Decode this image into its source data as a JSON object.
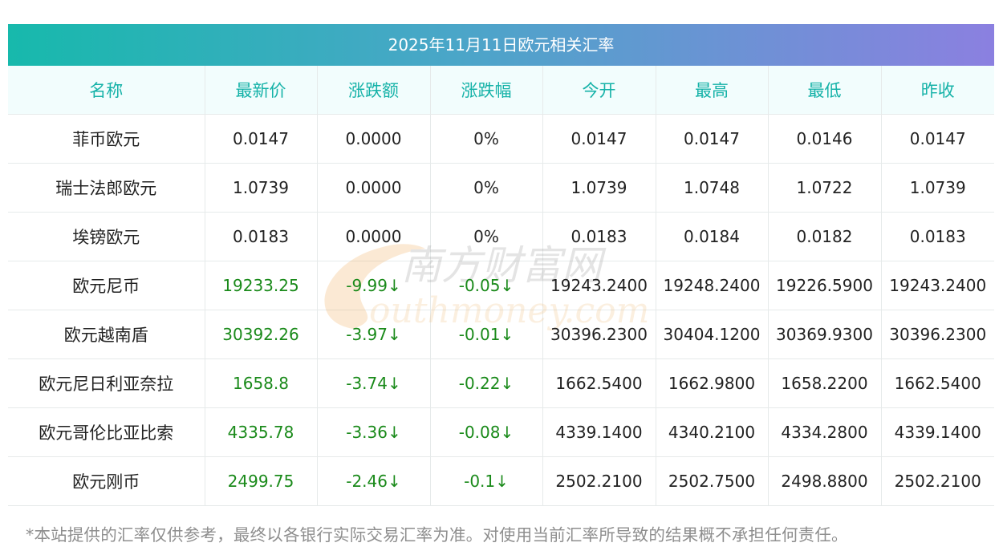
{
  "title": "2025年11月11日欧元相关汇率",
  "columns": [
    "名称",
    "最新价",
    "涨跌额",
    "涨跌幅",
    "今开",
    "最高",
    "最低",
    "昨收"
  ],
  "rows": [
    {
      "name": "菲币欧元",
      "latest": "0.0147",
      "change": "0.0000",
      "pct": "0%",
      "open": "0.0147",
      "high": "0.0147",
      "low": "0.0146",
      "prev": "0.0147",
      "trend": "flat"
    },
    {
      "name": "瑞士法郎欧元",
      "latest": "1.0739",
      "change": "0.0000",
      "pct": "0%",
      "open": "1.0739",
      "high": "1.0748",
      "low": "1.0722",
      "prev": "1.0739",
      "trend": "flat"
    },
    {
      "name": "埃镑欧元",
      "latest": "0.0183",
      "change": "0.0000",
      "pct": "0%",
      "open": "0.0183",
      "high": "0.0184",
      "low": "0.0182",
      "prev": "0.0183",
      "trend": "flat"
    },
    {
      "name": "欧元尼币",
      "latest": "19233.25",
      "change": "-9.99↓",
      "pct": "-0.05↓",
      "open": "19243.2400",
      "high": "19248.2400",
      "low": "19226.5900",
      "prev": "19243.2400",
      "trend": "down"
    },
    {
      "name": "欧元越南盾",
      "latest": "30392.26",
      "change": "-3.97↓",
      "pct": "-0.01↓",
      "open": "30396.2300",
      "high": "30404.1200",
      "low": "30369.9300",
      "prev": "30396.2300",
      "trend": "down"
    },
    {
      "name": "欧元尼日利亚奈拉",
      "latest": "1658.8",
      "change": "-3.74↓",
      "pct": "-0.22↓",
      "open": "1662.5400",
      "high": "1662.9800",
      "low": "1658.2200",
      "prev": "1662.5400",
      "trend": "down"
    },
    {
      "name": "欧元哥伦比亚比索",
      "latest": "4335.78",
      "change": "-3.36↓",
      "pct": "-0.08↓",
      "open": "4339.1400",
      "high": "4340.2100",
      "low": "4334.2800",
      "prev": "4339.1400",
      "trend": "down"
    },
    {
      "name": "欧元刚币",
      "latest": "2499.75",
      "change": "-2.46↓",
      "pct": "-0.1↓",
      "open": "2502.2100",
      "high": "2502.7500",
      "low": "2498.8800",
      "prev": "2502.2100",
      "trend": "down"
    }
  ],
  "footnote": "*本站提供的汇率仅供参考，最终以各银行实际交易汇率为准。对使用当前汇率所导致的结果概不承担任何责任。",
  "watermark": {
    "cn": "南方财富网",
    "en": "outhmoney.com"
  },
  "colors": {
    "header_text": "#15b2a8",
    "down": "#1a8a1a",
    "title_gradient": [
      "#17b9ac",
      "#8b80e0"
    ]
  }
}
